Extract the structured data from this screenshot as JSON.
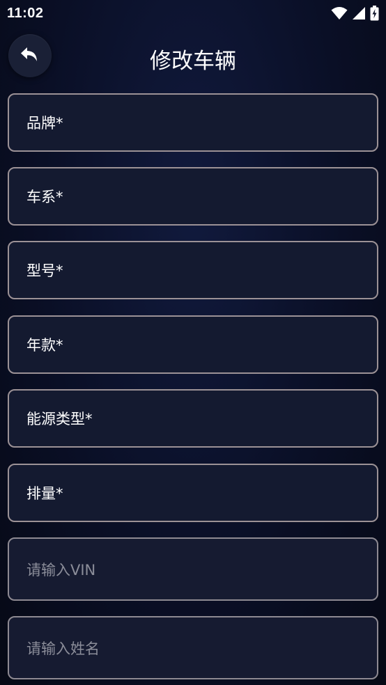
{
  "status_bar": {
    "time": "11:02",
    "icons": [
      "wifi-icon",
      "signal-icon",
      "battery-charging-icon"
    ]
  },
  "header": {
    "back_icon": "back-arrow-icon",
    "title": "修改车辆"
  },
  "form": {
    "fields": [
      {
        "label": "品牌*",
        "type": "select"
      },
      {
        "label": "车系*",
        "type": "select"
      },
      {
        "label": "型号*",
        "type": "select"
      },
      {
        "label": "年款*",
        "type": "select"
      },
      {
        "label": "能源类型*",
        "type": "select"
      },
      {
        "label": "排量*",
        "type": "select"
      }
    ],
    "vin_input": {
      "placeholder": "请输入VIN",
      "value": ""
    },
    "name_input": {
      "placeholder": "请输入姓名",
      "value": ""
    }
  },
  "colors": {
    "background": "#0b1026",
    "field_background": "#141a30",
    "field_border": "#9c9296",
    "text": "#ffffff",
    "placeholder": "#8b8d99"
  }
}
